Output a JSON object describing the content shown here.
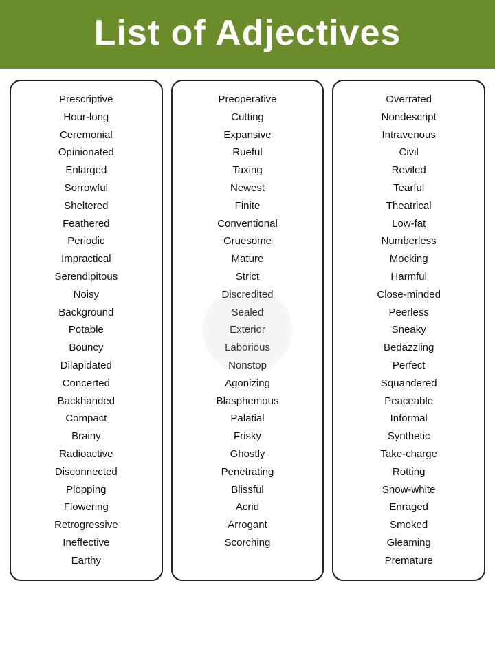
{
  "header": {
    "title": "List of Adjectives"
  },
  "columns": [
    {
      "id": "col1",
      "words": [
        "Prescriptive",
        "Hour-long",
        "Ceremonial",
        "Opinionated",
        "Enlarged",
        "Sorrowful",
        "Sheltered",
        "Feathered",
        "Periodic",
        "Impractical",
        "Serendipitous",
        "Noisy",
        "Background",
        "Potable",
        "Bouncy",
        "Dilapidated",
        "Concerted",
        "Backhanded",
        "Compact",
        "Brainy",
        "Radioactive",
        "Disconnected",
        "Plopping",
        "Flowering",
        "Retrogressive",
        "Ineffective",
        "Earthy"
      ]
    },
    {
      "id": "col2",
      "words": [
        "Preoperative",
        "Cutting",
        "Expansive",
        "Rueful",
        "Taxing",
        "Newest",
        "Finite",
        "Conventional",
        "Gruesome",
        "Mature",
        "Strict",
        "Discredited",
        "Sealed",
        "Exterior",
        "Laborious",
        "Nonstop",
        "Agonizing",
        "Blasphemous",
        "Palatial",
        "Frisky",
        "Ghostly",
        "Penetrating",
        "Blissful",
        "Acrid",
        "Arrogant",
        "Scorching"
      ]
    },
    {
      "id": "col3",
      "words": [
        "Overrated",
        "Nondescript",
        "Intravenous",
        "Civil",
        "Reviled",
        "Tearful",
        "Theatrical",
        "Low-fat",
        "Numberless",
        "Mocking",
        "Harmful",
        "Close-minded",
        "Peerless",
        "Sneaky",
        "Bedazzling",
        "Perfect",
        "Squandered",
        "Peaceable",
        "Informal",
        "Synthetic",
        "Take-charge",
        "Rotting",
        "Snow-white",
        "Enraged",
        "Smoked",
        "Gleaming",
        "Premature"
      ]
    }
  ]
}
